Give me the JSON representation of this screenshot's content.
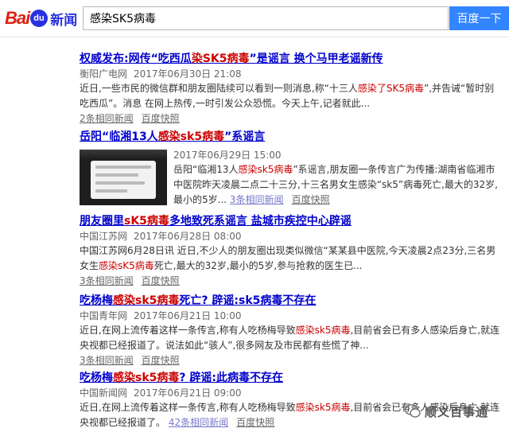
{
  "search": {
    "query": "感染SK5病毒",
    "button": "百度一下"
  },
  "logo": {
    "bai": "Bai",
    "du": "du",
    "xinwen": "新闻"
  },
  "results": [
    {
      "title": [
        {
          "t": "权威发布:网传“吃西瓜"
        },
        {
          "t": "染SK5病毒",
          "hl": true
        },
        {
          "t": "”是谣言 换个马甲老谣新传"
        }
      ],
      "source": "衡阳广电网",
      "date": "2017年06月30日 21:08",
      "abstract": [
        {
          "t": "近日,一些市民的微信群和朋友圈陆续可以看到一则消息,称“十三人"
        },
        {
          "t": "感染了SK5病毒",
          "hl": true
        },
        {
          "t": "”,并告诫“暂时别吃西瓜”。消息 在网上热传,一时引发公众恐慌。今天上午,记者就此..."
        }
      ],
      "links": [
        "2条相同新闻",
        "百度快照"
      ]
    },
    {
      "title": [
        {
          "t": "岳阳“临湘13人"
        },
        {
          "t": "感染sk5病毒",
          "hl": true
        },
        {
          "t": "”系谣言"
        }
      ],
      "source": "",
      "date": "2017年06月29日 15:00",
      "abstract": [
        {
          "t": "岳阳“临湘13人"
        },
        {
          "t": "感染sk5病毒",
          "hl": true
        },
        {
          "t": "”系谣言,朋友圈一条传言广为传播:湖南省临湘市中医院昨天凌晨二点二十三分,十三名男女生感染“sk5”病毒死亡,最大的32岁,最小的5岁..."
        }
      ],
      "links": [
        "3条相同新闻",
        "百度快照"
      ]
    },
    {
      "title": [
        {
          "t": "朋友圈里"
        },
        {
          "t": "sK5病毒",
          "hl": true
        },
        {
          "t": "多地致死系谣言 盐城市疾控中心辟谣"
        }
      ],
      "source": "中国江苏网",
      "date": "2017年06月28日 08:00",
      "abstract": [
        {
          "t": "中国江苏网6月28日讯 近日,不少人的朋友圈出现类似微信“某某县中医院,今天凌晨2点23分,三名男女生"
        },
        {
          "t": "感染sK5病毒",
          "hl": true
        },
        {
          "t": "死亡,最大的32岁,最小的5岁,参与抢救的医生已..."
        }
      ],
      "links": [
        "3条相同新闻",
        "百度快照"
      ]
    },
    {
      "title": [
        {
          "t": "吃杨梅"
        },
        {
          "t": "感染sk5病毒",
          "hl": true
        },
        {
          "t": "死亡? 辟谣:sk5病毒不存在"
        }
      ],
      "source": "中国青年网",
      "date": "2017年06月21日 10:00",
      "abstract": [
        {
          "t": "近日,在网上流传着这样一条传言,称有人吃杨梅导致"
        },
        {
          "t": "感染sk5病毒",
          "hl": true
        },
        {
          "t": ",目前省会已有多人感染后身亡,就连央视都已经报道了。说法如此“骇人”,很多网友及市民都有些慌了神..."
        }
      ],
      "links": [
        "3条相同新闻",
        "百度快照"
      ]
    },
    {
      "title": [
        {
          "t": "吃杨梅"
        },
        {
          "t": "感染sk5病毒",
          "hl": true
        },
        {
          "t": "? 辟谣:此病毒不存在"
        }
      ],
      "source": "中国新闻网",
      "date": "2017年06月21日 09:00",
      "abstract": [
        {
          "t": "近日,在网上流传着这样一条传言,称有人吃杨梅导致"
        },
        {
          "t": "感染sk5病毒",
          "hl": true
        },
        {
          "t": ",目前省会已有多人感染后身亡,就连央视都已经报道了。"
        }
      ],
      "links": [
        "42条相同新闻",
        "百度快照"
      ]
    }
  ],
  "watermark": "顺义百事通"
}
